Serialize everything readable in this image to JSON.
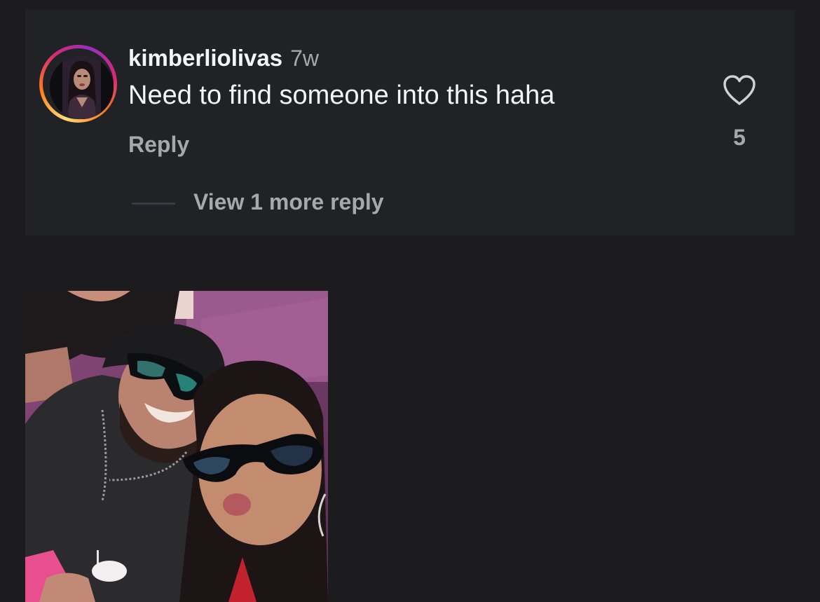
{
  "comment": {
    "username": "kimberliolivas",
    "time_ago": "7w",
    "text": "Need to find someone into this haha",
    "reply_label": "Reply",
    "like_count": "5",
    "view_more_label": "View 1 more reply",
    "like_icon": "heart-outline-icon"
  },
  "colors": {
    "background": "#1c1c1e",
    "card_background": "#212226",
    "primary_text": "#f5f5f5",
    "secondary_text": "#a8a8a8",
    "story_ring": [
      "#feda75",
      "#fa7e1e",
      "#d62976",
      "#962fbf"
    ]
  },
  "media": {
    "kind": "photo",
    "subject": "selfie of a man in a black cap and sunglasses with a woman in sunglasses"
  }
}
